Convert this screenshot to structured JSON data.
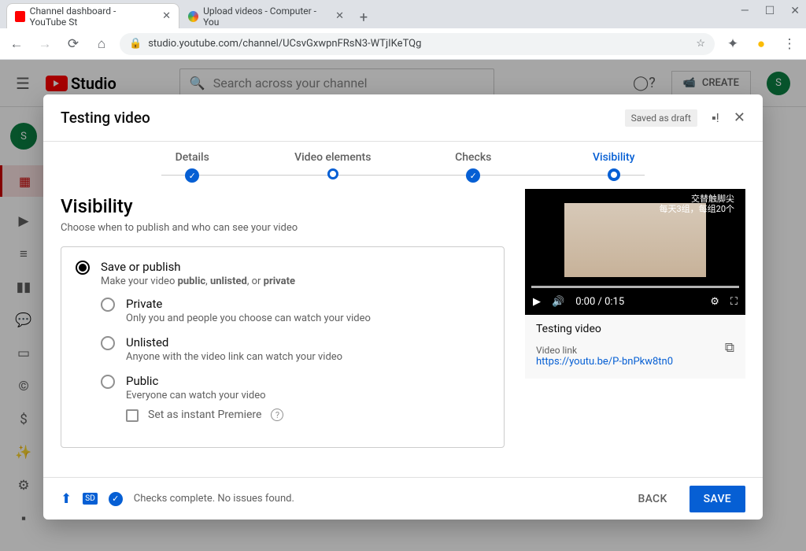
{
  "browser": {
    "tabs": [
      {
        "title": "Channel dashboard - YouTube St"
      },
      {
        "title": "Upload videos - Computer - You"
      }
    ],
    "url": "studio.youtube.com/channel/UCsvGxwpnFRsN3-WTjIKeTQg"
  },
  "masthead": {
    "logo_text": "Studio",
    "search_placeholder": "Search across your channel",
    "create_label": "CREATE",
    "avatar_initial": "S"
  },
  "dialog": {
    "title": "Testing video",
    "draft_badge": "Saved as draft",
    "stepper": {
      "details": "Details",
      "video_elements": "Video elements",
      "checks": "Checks",
      "visibility": "Visibility"
    },
    "section": {
      "heading": "Visibility",
      "subheading": "Choose when to publish and who can see your video"
    },
    "options": {
      "save_publish": {
        "label": "Save or publish",
        "desc_pre": "Make your video ",
        "desc_b1": "public",
        "desc_sep1": ", ",
        "desc_b2": "unlisted",
        "desc_sep2": ", or ",
        "desc_b3": "private"
      },
      "private": {
        "label": "Private",
        "desc": "Only you and people you choose can watch your video"
      },
      "unlisted": {
        "label": "Unlisted",
        "desc": "Anyone with the video link can watch your video"
      },
      "public": {
        "label": "Public",
        "desc": "Everyone can watch your video"
      },
      "premiere": {
        "label": "Set as instant Premiere"
      }
    },
    "preview": {
      "cn_line1": "交替触脚尖",
      "cn_line2": "每天3组，每组20个",
      "time": "0:00 / 0:15",
      "video_name": "Testing video",
      "link_label": "Video link",
      "link_url": "https://youtu.be/P-bnPkw8tn0"
    },
    "footer": {
      "status": "Checks complete. No issues found.",
      "back": "BACK",
      "save": "SAVE"
    }
  }
}
